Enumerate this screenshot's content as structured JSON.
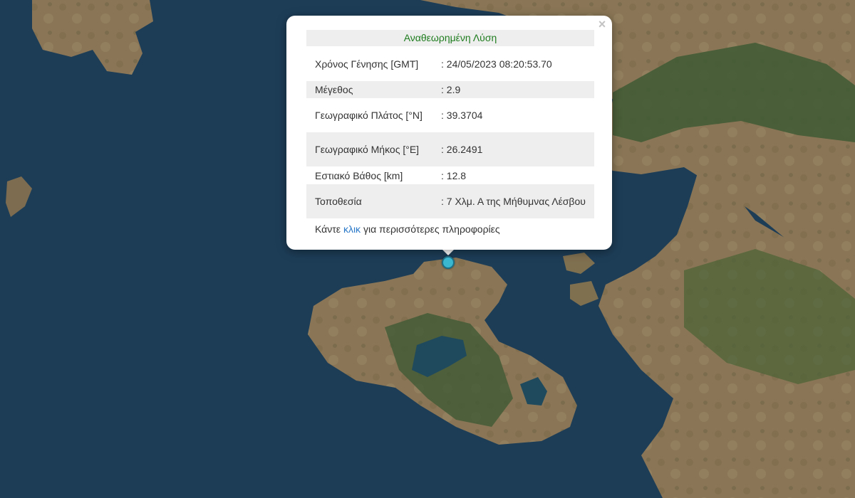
{
  "popup": {
    "status": "Αναθεωρημένη Λύση",
    "close_symbol": "×",
    "rows": [
      {
        "label": "Χρόνος Γένησης [GMT]",
        "value": ": 24/05/2023 08:20:53.70"
      },
      {
        "label": "Μέγεθος",
        "value": ": 2.9"
      },
      {
        "label": "Γεωγραφικό Πλάτος [°N]",
        "value": ": 39.3704"
      },
      {
        "label": "Γεωγραφικό Μήκος [°E]",
        "value": ": 26.2491"
      },
      {
        "label": "Εστιακό Βάθος [km]",
        "value": ": 12.8"
      },
      {
        "label": "Τοποθεσία",
        "value": ": 7 Χλμ. Α της Μήθυμνας Λέσβου"
      }
    ],
    "more_prefix": "Κάντε",
    "more_link": "κλικ",
    "more_suffix": "για περισσότερες πληροφορίες"
  },
  "colors": {
    "sea": "#1d3d57",
    "land": "#8a7656",
    "forest": "#3e5a34",
    "lake": "#1f4a5e",
    "marker": "#3bb7cf",
    "status_text": "#1e7c1e",
    "link": "#2a78c8"
  },
  "icons": {
    "close": "close-icon",
    "marker": "earthquake-epicenter-marker"
  }
}
